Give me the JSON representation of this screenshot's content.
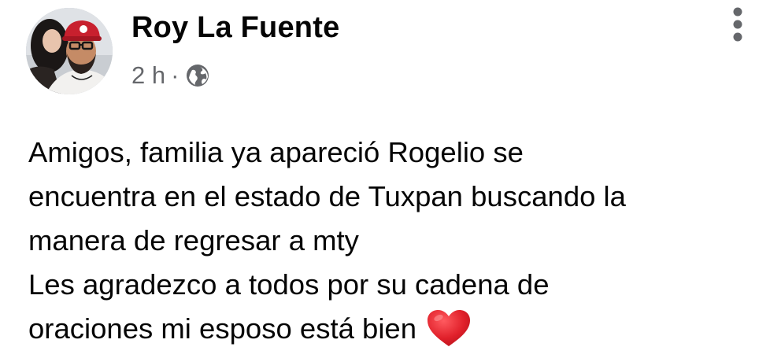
{
  "post": {
    "author": {
      "name": "Roy La Fuente",
      "avatar_icon": "profile-photo"
    },
    "meta": {
      "time": "2 h",
      "separator": "·",
      "audience_icon": "globe-icon"
    },
    "menu_icon": "more-vertical-icon",
    "body": {
      "paragraph_1_lines": [
        "Amigos, familia ya apareció Rogelio se",
        "encuentra en el estado de Tuxpan buscando la",
        "manera de regresar a mty"
      ],
      "paragraph_2_lines": [
        "Les agradezco a todos por su cadena de",
        "oraciones mi esposo está bien"
      ],
      "emoji_icon": "red-heart-icon"
    }
  },
  "colors": {
    "background": "#ffffff",
    "text": "#050505",
    "secondary_text": "#65676b",
    "heart": "#e0202a"
  }
}
